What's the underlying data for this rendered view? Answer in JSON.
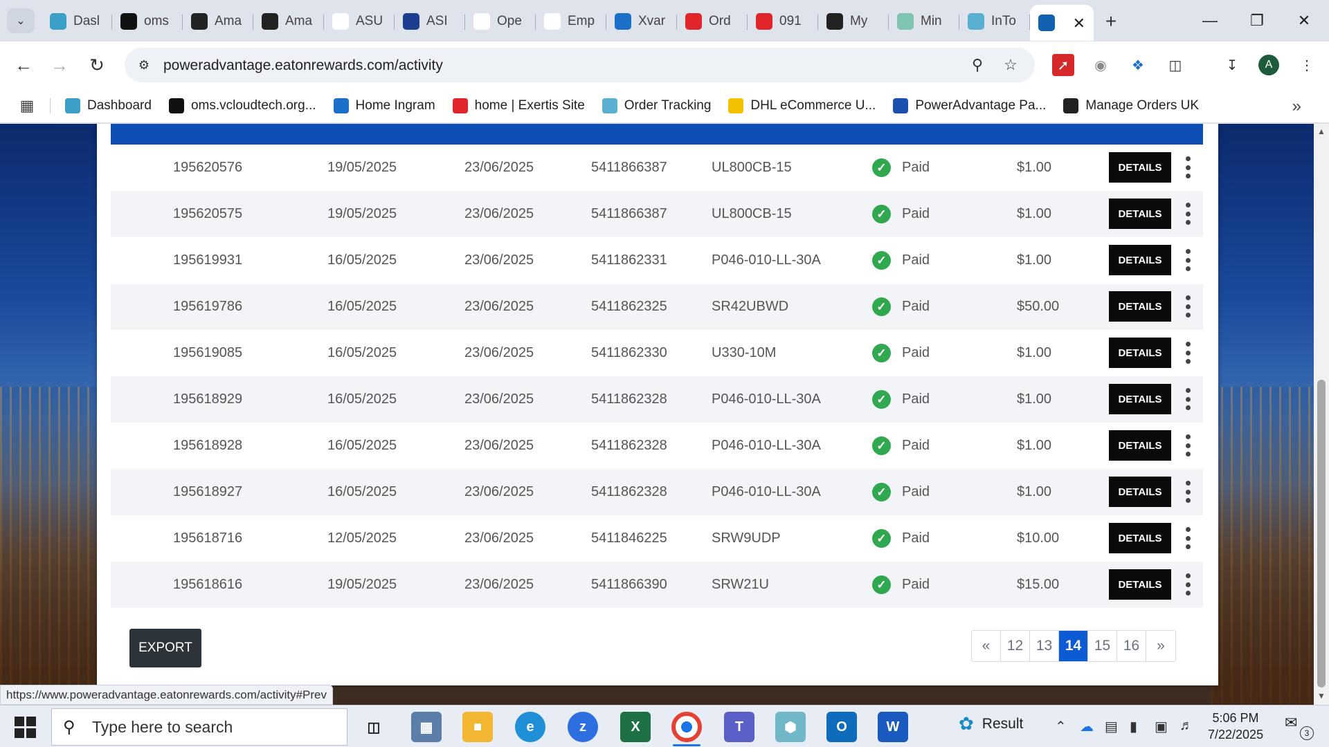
{
  "browser": {
    "tabs": [
      {
        "title": "Dasl",
        "icon": "hexagon-icon",
        "color": "#3aa0c8"
      },
      {
        "title": "oms",
        "icon": "delta-icon",
        "color": "#111111"
      },
      {
        "title": "Ama",
        "icon": "amazon-icon",
        "color": "#222222"
      },
      {
        "title": "Ama",
        "icon": "amazon-icon",
        "color": "#222222"
      },
      {
        "title": "ASU",
        "icon": "amazon-a-icon",
        "color": "#ffffff"
      },
      {
        "title": "ASI",
        "icon": "arrow-icon",
        "color": "#1d3d8f"
      },
      {
        "title": "Ope",
        "icon": "openai-icon",
        "color": "#ffffff"
      },
      {
        "title": "Emp",
        "icon": "openai-icon",
        "color": "#ffffff"
      },
      {
        "title": "Xvar",
        "icon": "x-icon",
        "color": "#1b6fc8"
      },
      {
        "title": "Ord",
        "icon": "exertis-icon",
        "color": "#e0262b"
      },
      {
        "title": "091",
        "icon": "exertis-icon",
        "color": "#e0262b"
      },
      {
        "title": "My",
        "icon": "tag-icon",
        "color": "#222222"
      },
      {
        "title": "Min",
        "icon": "leaf-icon",
        "color": "#7fc4b0"
      },
      {
        "title": "InTo",
        "icon": "c-icon",
        "color": "#5ab0d0"
      },
      {
        "title": "",
        "icon": "eaton-icon",
        "color": "#1261b0",
        "active": true
      }
    ],
    "new_tab": "+",
    "url": "poweradvantage.eatonrewards.com/activity",
    "avatar_letter": "A",
    "bookmarks": [
      {
        "label": "Dashboard",
        "icon": "hexagon-icon",
        "color": "#3aa0c8"
      },
      {
        "label": "oms.vcloudtech.org...",
        "icon": "delta-icon",
        "color": "#111111"
      },
      {
        "label": "Home Ingram",
        "icon": "ingram-icon",
        "color": "#1b6fc8"
      },
      {
        "label": "home | Exertis Site",
        "icon": "exertis-icon",
        "color": "#e0262b"
      },
      {
        "label": "Order Tracking",
        "icon": "c-icon",
        "color": "#5ab0d0"
      },
      {
        "label": "DHL eCommerce U...",
        "icon": "dhl-icon",
        "color": "#f2c200"
      },
      {
        "label": "PowerAdvantage Pa...",
        "icon": "document-icon",
        "color": "#1b4fb0"
      },
      {
        "label": "Manage Orders UK",
        "icon": "amazon-icon",
        "color": "#222222"
      }
    ],
    "status_url": "https://www.poweradvantage.eatonrewards.com/activity#Prev"
  },
  "table": {
    "rows": [
      {
        "id": "195620576",
        "date1": "19/05/2025",
        "date2": "23/06/2025",
        "po": "5411866387",
        "model": "UL800CB-15",
        "status": "Paid",
        "amount": "$1.00",
        "action": "DETAILS"
      },
      {
        "id": "195620575",
        "date1": "19/05/2025",
        "date2": "23/06/2025",
        "po": "5411866387",
        "model": "UL800CB-15",
        "status": "Paid",
        "amount": "$1.00",
        "action": "DETAILS"
      },
      {
        "id": "195619931",
        "date1": "16/05/2025",
        "date2": "23/06/2025",
        "po": "5411862331",
        "model": "P046-010-LL-30A",
        "status": "Paid",
        "amount": "$1.00",
        "action": "DETAILS"
      },
      {
        "id": "195619786",
        "date1": "16/05/2025",
        "date2": "23/06/2025",
        "po": "5411862325",
        "model": "SR42UBWD",
        "status": "Paid",
        "amount": "$50.00",
        "action": "DETAILS"
      },
      {
        "id": "195619085",
        "date1": "16/05/2025",
        "date2": "23/06/2025",
        "po": "5411862330",
        "model": "U330-10M",
        "status": "Paid",
        "amount": "$1.00",
        "action": "DETAILS"
      },
      {
        "id": "195618929",
        "date1": "16/05/2025",
        "date2": "23/06/2025",
        "po": "5411862328",
        "model": "P046-010-LL-30A",
        "status": "Paid",
        "amount": "$1.00",
        "action": "DETAILS"
      },
      {
        "id": "195618928",
        "date1": "16/05/2025",
        "date2": "23/06/2025",
        "po": "5411862328",
        "model": "P046-010-LL-30A",
        "status": "Paid",
        "amount": "$1.00",
        "action": "DETAILS"
      },
      {
        "id": "195618927",
        "date1": "16/05/2025",
        "date2": "23/06/2025",
        "po": "5411862328",
        "model": "P046-010-LL-30A",
        "status": "Paid",
        "amount": "$1.00",
        "action": "DETAILS"
      },
      {
        "id": "195618716",
        "date1": "12/05/2025",
        "date2": "23/06/2025",
        "po": "5411846225",
        "model": "SRW9UDP",
        "status": "Paid",
        "amount": "$10.00",
        "action": "DETAILS"
      },
      {
        "id": "195618616",
        "date1": "19/05/2025",
        "date2": "23/06/2025",
        "po": "5411866390",
        "model": "SRW21U",
        "status": "Paid",
        "amount": "$15.00",
        "action": "DETAILS"
      }
    ],
    "status_color": "#2fa84f"
  },
  "export_label": "EXPORT",
  "pagination": {
    "first": "«",
    "pages": [
      "12",
      "13",
      "14",
      "15",
      "16"
    ],
    "current": "14",
    "last": "»"
  },
  "taskbar": {
    "search_placeholder": "Type here to search",
    "weather_label": "Result",
    "time": "5:06 PM",
    "date": "7/22/2025",
    "notification_count": "3"
  }
}
